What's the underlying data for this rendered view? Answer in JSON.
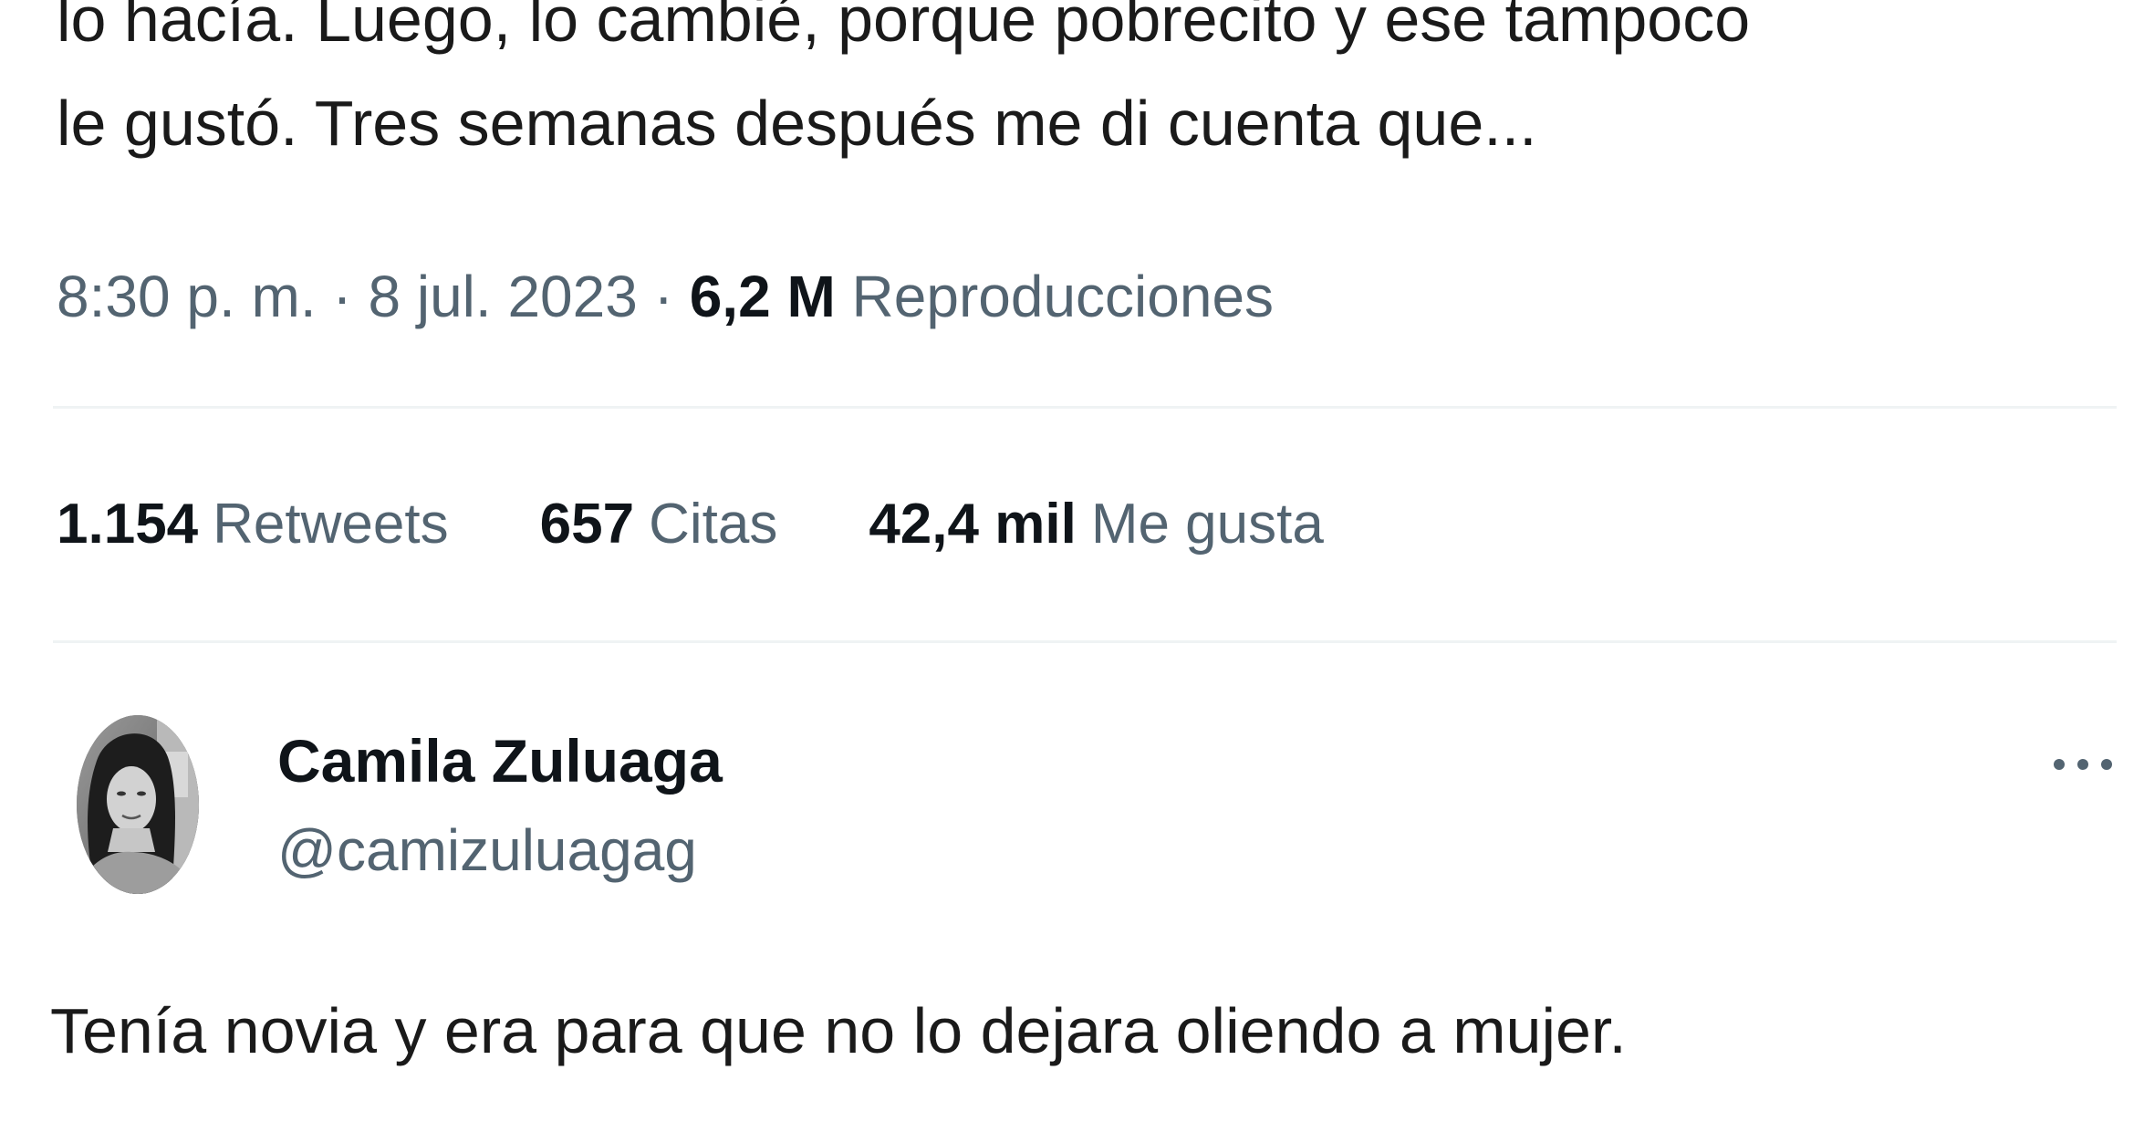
{
  "tweet": {
    "text_line1": "lo hacía. Luego, lo cambié, porque pobrecito y ese tampoco",
    "text_line2": "le gustó. Tres semanas después me di cuenta que...",
    "meta": {
      "time": "8:30 p. m.",
      "separator1": " · ",
      "date": "8 jul. 2023",
      "separator2": " · ",
      "views_count": "6,2 M",
      "views_label": "Reproducciones"
    },
    "stats": {
      "retweets_count": "1.154",
      "retweets_label": "Retweets",
      "quotes_count": "657",
      "quotes_label": "Citas",
      "likes_count": "42,4 mil",
      "likes_label": "Me gusta"
    }
  },
  "reply": {
    "author_name": "Camila Zuluaga",
    "author_handle": "@camizuluagag",
    "avatar_icon": "profile-photo",
    "more_icon": "more-options-icon",
    "text": "Tenía novia y era para que no lo dejara oliendo a mujer."
  },
  "colors": {
    "primary_text": "#0f1419",
    "secondary_text": "#536471",
    "divider": "#eff3f4",
    "background": "#ffffff"
  }
}
